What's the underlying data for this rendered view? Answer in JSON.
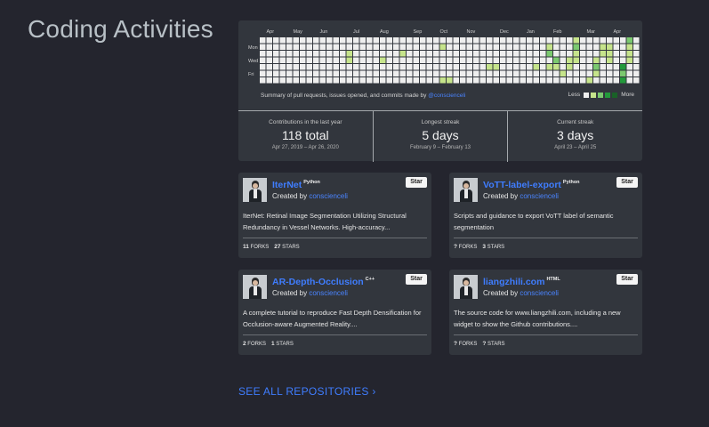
{
  "page": {
    "title": "Coding Activities"
  },
  "calendar": {
    "months": [
      "Apr",
      "May",
      "Jun",
      "Jul",
      "Aug",
      "Sep",
      "Oct",
      "Nov",
      "Dec",
      "Jan",
      "Feb",
      "Mar",
      "Apr"
    ],
    "days": [
      "Mon",
      "Wed",
      "Fri"
    ],
    "summary_prefix": "Summary of pull requests, issues opened, and commits made by ",
    "summary_user": "@conscienceli",
    "legend_less": "Less",
    "legend_more": "More",
    "colors": [
      "#eeeeee",
      "#c6e48b",
      "#7bc96f",
      "#239a3b",
      "#196127"
    ],
    "active_cells": [
      [
        13,
        2,
        1
      ],
      [
        13,
        3,
        1
      ],
      [
        18,
        3,
        1
      ],
      [
        21,
        2,
        1
      ],
      [
        27,
        1,
        1
      ],
      [
        27,
        6,
        1
      ],
      [
        28,
        6,
        1
      ],
      [
        34,
        4,
        1
      ],
      [
        35,
        4,
        1
      ],
      [
        41,
        4,
        1
      ],
      [
        43,
        1,
        1
      ],
      [
        43,
        2,
        2
      ],
      [
        43,
        4,
        1
      ],
      [
        44,
        3,
        2
      ],
      [
        44,
        4,
        1
      ],
      [
        45,
        5,
        1
      ],
      [
        46,
        3,
        1
      ],
      [
        46,
        4,
        1
      ],
      [
        47,
        0,
        1
      ],
      [
        47,
        1,
        2
      ],
      [
        47,
        2,
        1
      ],
      [
        47,
        3,
        1
      ],
      [
        49,
        6,
        1
      ],
      [
        50,
        3,
        1
      ],
      [
        50,
        4,
        2
      ],
      [
        50,
        5,
        1
      ],
      [
        51,
        1,
        1
      ],
      [
        51,
        2,
        1
      ],
      [
        52,
        1,
        1
      ],
      [
        52,
        2,
        1
      ],
      [
        52,
        3,
        1
      ],
      [
        54,
        4,
        3
      ],
      [
        54,
        5,
        2
      ],
      [
        54,
        6,
        3
      ],
      [
        55,
        0,
        2
      ],
      [
        55,
        1,
        1
      ],
      [
        55,
        2,
        1
      ],
      [
        55,
        3,
        1
      ]
    ]
  },
  "stats": [
    {
      "label": "Contributions in the last year",
      "value": "118 total",
      "range": "Apr 27, 2019 – Apr 26, 2020"
    },
    {
      "label": "Longest streak",
      "value": "5 days",
      "range": "February 9 – February 13"
    },
    {
      "label": "Current streak",
      "value": "3 days",
      "range": "April 23 – April 25"
    }
  ],
  "repos": [
    {
      "name": "IterNet",
      "lang": "Python",
      "created_by": "Created by ",
      "user": "conscienceli",
      "star": "Star",
      "desc": "IterNet: Retinal Image Segmentation Utilizing Structural Redundancy in Vessel Networks. High-accuracy...",
      "forks": "11",
      "forks_label": "FORKS",
      "stars": "27",
      "stars_label": "STARS"
    },
    {
      "name": "VoTT-label-export",
      "lang": "Python",
      "created_by": "Created by ",
      "user": "conscienceli",
      "star": "Star",
      "desc": "Scripts and guidance to export VoTT label of semantic segmentation",
      "forks": "?",
      "forks_label": "FORKS",
      "stars": "3",
      "stars_label": "STARS"
    },
    {
      "name": "AR-Depth-Occlusion",
      "lang": "C++",
      "created_by": "Created by ",
      "user": "conscienceli",
      "star": "Star",
      "desc": "A complete tutorial to reproduce Fast Depth Densification for Occlusion-aware Augmented Reality....",
      "forks": "2",
      "forks_label": "FORKS",
      "stars": "1",
      "stars_label": "STARS"
    },
    {
      "name": "liangzhili.com",
      "lang": "HTML",
      "created_by": "Created by ",
      "user": "conscienceli",
      "star": "Star",
      "desc": "The source code for www.liangzhili.com, including a new widget to show the Github contributions....",
      "forks": "?",
      "forks_label": "FORKS",
      "stars": "?",
      "stars_label": "STARS"
    }
  ],
  "see_all": "SEE ALL REPOSITORIES ›"
}
